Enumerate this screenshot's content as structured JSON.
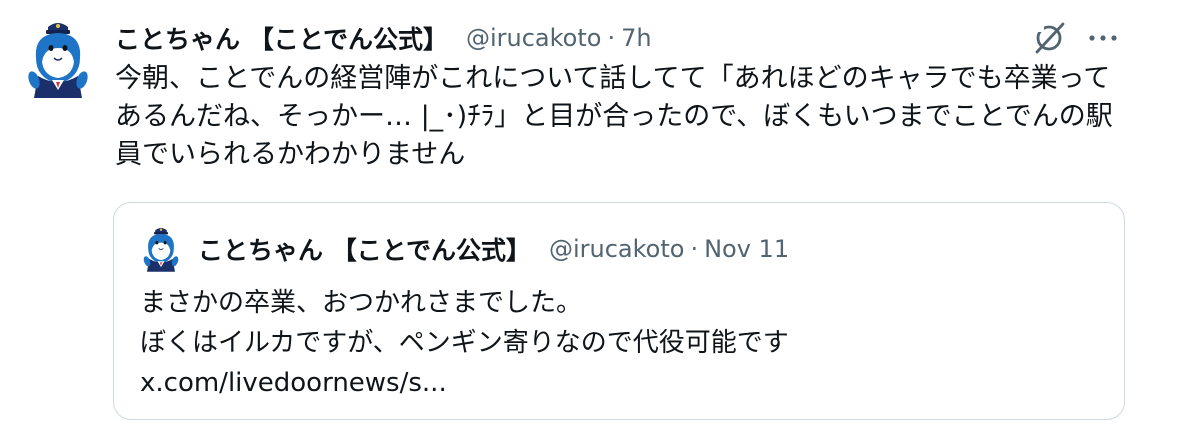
{
  "tweet": {
    "display_name": "ことちゃん 【ことでん公式】",
    "handle": "@irucakoto",
    "separator": "·",
    "time": "7h",
    "text": "今朝、ことでんの経営陣がこれについて話してて「あれほどのキャラでも卒業ってあるんだね、そっかー… |_･)ﾁﾗ」と目が合ったので、ぼくもいつまでことでんの駅員でいられるかわかりません",
    "icons": {
      "avatar": "dolphin-mascot-avatar",
      "grok": "grok-icon",
      "more": "more-icon"
    }
  },
  "quoted_tweet": {
    "display_name": "ことちゃん 【ことでん公式】",
    "handle": "@irucakoto",
    "separator": "·",
    "time": "Nov 11",
    "lines": [
      "まさかの卒業、おつかれさまでした。",
      "ぼくはイルカですが、ペンギン寄りなので代役可能です",
      "x.com/livedoornews/s..."
    ]
  },
  "colors": {
    "text_primary": "#0f1419",
    "text_secondary": "#536471",
    "border": "#cfd9de",
    "mascot_blue": "#1e74c6"
  }
}
